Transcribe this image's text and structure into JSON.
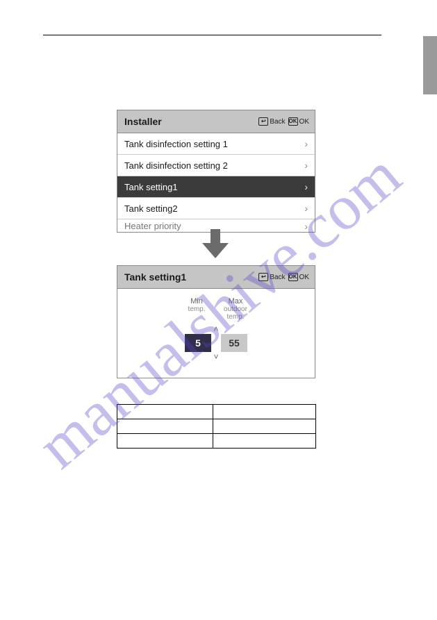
{
  "watermark": "manualshive.com",
  "installer_panel": {
    "title": "Installer",
    "back_label": "Back",
    "ok_label": "OK",
    "items": [
      {
        "label": "Tank disinfection setting 1",
        "selected": false
      },
      {
        "label": "Tank disinfection setting 2",
        "selected": false
      },
      {
        "label": "Tank setting1",
        "selected": true
      },
      {
        "label": "Tank setting2",
        "selected": false
      },
      {
        "label": "Heater priority",
        "selected": false,
        "cut": true
      }
    ]
  },
  "tank_panel": {
    "title": "Tank setting1",
    "back_label": "Back",
    "ok_label": "OK",
    "col1_top": "Min",
    "col2_top": "Max",
    "col1_sub": "temp.",
    "col2_sub": "outdoor temp.",
    "value1": "5",
    "value2": "55"
  },
  "icons": {
    "back_glyph": "↩",
    "ok_glyph": "OK",
    "chevron_right": "›",
    "chevron_up": "˄",
    "chevron_down": "˅"
  }
}
